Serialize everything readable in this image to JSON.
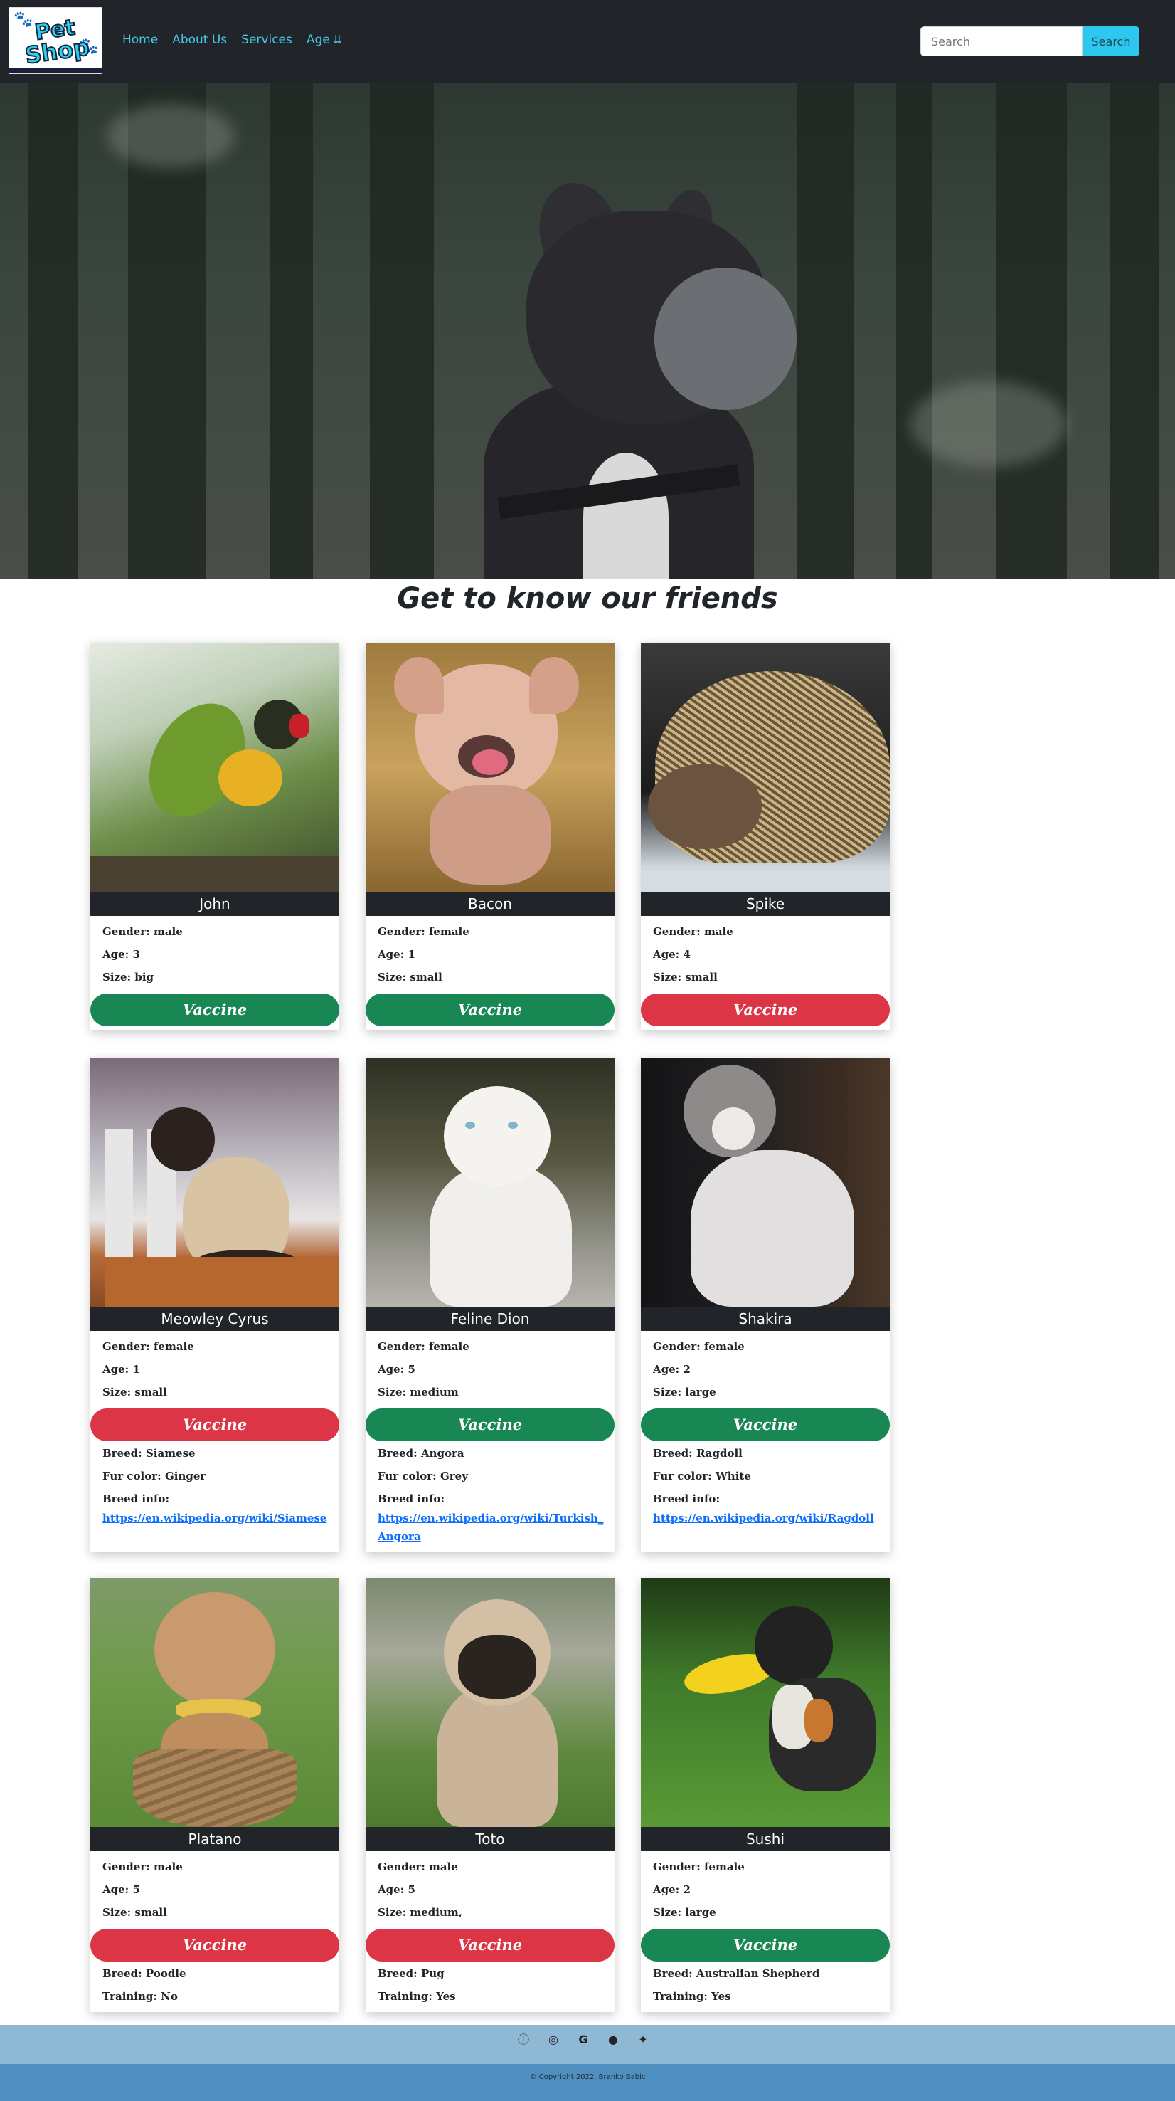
{
  "nav": {
    "logo_line1": "Pet",
    "logo_line2": "Shop",
    "links": [
      "Home",
      "About Us",
      "Services",
      "Age"
    ],
    "search_placeholder": "Search",
    "search_button": "Search"
  },
  "main": {
    "title": "Get to know our friends"
  },
  "labels": {
    "gender": "Gender:",
    "age": "Age:",
    "size": "Size:",
    "vaccine": "Vaccine",
    "breed": "Breed:",
    "fur": "Fur color:",
    "breed_info": "Breed info:",
    "training": "Training:"
  },
  "pets": [
    {
      "name": "John",
      "gender": "male",
      "age": "3",
      "size": "big",
      "vaccinated": true
    },
    {
      "name": "Bacon",
      "gender": "female",
      "age": "1",
      "size": "small",
      "vaccinated": true
    },
    {
      "name": "Spike",
      "gender": "male",
      "age": "4",
      "size": "small",
      "vaccinated": false
    },
    {
      "name": "Meowley Cyrus",
      "gender": "female",
      "age": "1",
      "size": "small",
      "vaccinated": false,
      "breed": "Siamese",
      "fur": "Ginger",
      "link": "https://en.wikipedia.org/wiki/Siamese"
    },
    {
      "name": "Feline Dion",
      "gender": "female",
      "age": "5",
      "size": "medium",
      "vaccinated": true,
      "breed": "Angora",
      "fur": "Grey",
      "link": "https://en.wikipedia.org/wiki/Turkish_Angora"
    },
    {
      "name": "Shakira",
      "gender": "female",
      "age": "2",
      "size": "large",
      "vaccinated": true,
      "breed": "Ragdoll",
      "fur": "White",
      "link": "https://en.wikipedia.org/wiki/Ragdoll"
    },
    {
      "name": "Platano",
      "gender": "male",
      "age": "5",
      "size": "small",
      "vaccinated": false,
      "breed": "Poodle",
      "training": "No"
    },
    {
      "name": "Toto",
      "gender": "male",
      "age": "5",
      "size": "medium,",
      "vaccinated": false,
      "breed": "Pug",
      "training": "Yes"
    },
    {
      "name": "Sushi",
      "gender": "female",
      "age": "2",
      "size": "large",
      "vaccinated": true,
      "breed": "Australian Shepherd",
      "training": "Yes"
    }
  ],
  "footer": {
    "icons": [
      "facebook-icon",
      "instagram-icon",
      "google-icon",
      "github-icon",
      "twitter-icon"
    ],
    "copyright": "© Copyright 2022, Branko Babic"
  },
  "colors": {
    "vaccinated": "#198754",
    "not_vaccinated": "#dc3545",
    "nav_bg": "#212529",
    "link": "#45c6e6"
  }
}
